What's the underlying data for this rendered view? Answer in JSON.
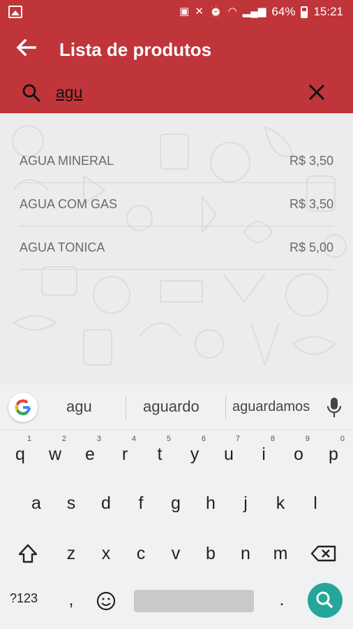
{
  "status_bar": {
    "battery": "64%",
    "time": "15:21",
    "icons": [
      "image-icon",
      "sim-icon",
      "mute-icon",
      "alarm-icon",
      "wifi-icon",
      "signal-icon",
      "battery-icon"
    ]
  },
  "toolbar": {
    "title": "Lista de produtos",
    "back_icon": "arrow-back-icon"
  },
  "search": {
    "value": "agu",
    "search_icon": "search-icon",
    "clear_icon": "close-icon"
  },
  "products": [
    {
      "name": "AGUA MINERAL",
      "price": "R$ 3,50"
    },
    {
      "name": "AGUA COM GAS",
      "price": "R$ 3,50"
    },
    {
      "name": "AGUA TONICA",
      "price": "R$ 5,00"
    }
  ],
  "keyboard": {
    "suggestions": [
      "agu",
      "aguardo",
      "aguardamos"
    ],
    "row1": [
      {
        "key": "q",
        "hint": "1"
      },
      {
        "key": "w",
        "hint": "2"
      },
      {
        "key": "e",
        "hint": "3"
      },
      {
        "key": "r",
        "hint": "4"
      },
      {
        "key": "t",
        "hint": "5"
      },
      {
        "key": "y",
        "hint": "6"
      },
      {
        "key": "u",
        "hint": "7"
      },
      {
        "key": "i",
        "hint": "8"
      },
      {
        "key": "o",
        "hint": "9"
      },
      {
        "key": "p",
        "hint": "0"
      }
    ],
    "row2": [
      "a",
      "s",
      "d",
      "f",
      "g",
      "h",
      "j",
      "k",
      "l"
    ],
    "row3": [
      "z",
      "x",
      "c",
      "v",
      "b",
      "n",
      "m"
    ],
    "symbols_label": "?123",
    "comma": ",",
    "period": ".",
    "accent_color": "#26a69a"
  },
  "colors": {
    "primary": "#c0353a"
  }
}
